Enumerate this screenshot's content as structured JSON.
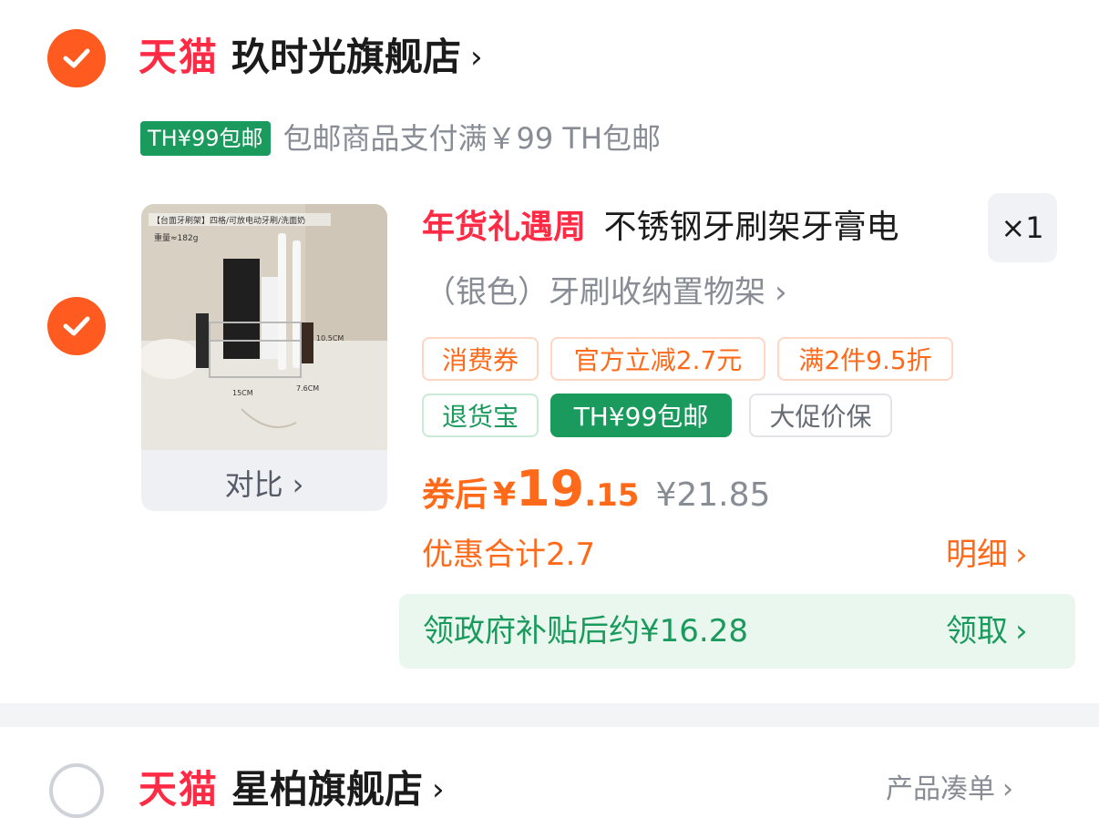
{
  "store1": {
    "brand": "天猫",
    "name": "玖时光旗舰店",
    "chevron": "›",
    "shipping_badge": "TH¥99包邮",
    "shipping_note": "包邮商品支付满￥99 TH包邮"
  },
  "product": {
    "promo_tag": "年货礼遇周",
    "title": "不锈钢牙刷架牙膏电",
    "spec": "（银色）牙刷收纳置物架",
    "quantity": "×1",
    "compare_label": "对比",
    "image_text": {
      "banner": "【台面牙刷架】四格/可放电动牙刷/洗面奶",
      "weight": "重量≈182g",
      "dim_width": "15CM",
      "dim_depth": "7.6CM",
      "dim_height": "10.5CM"
    },
    "tags_row1": [
      "消费券",
      "官方立减2.7元",
      "满2件9.5折"
    ],
    "tags_row2": [
      "退货宝",
      "TH¥99包邮",
      "大促价保"
    ],
    "price_label": "券后",
    "currency": "¥",
    "price_int": "19",
    "price_dec": ".15",
    "original_price": "¥21.85",
    "discount_total": "优惠合计2.7",
    "detail_label": "明细",
    "subsidy_text": "领政府补贴后约¥16.28",
    "subsidy_action": "领取"
  },
  "store2": {
    "brand": "天猫",
    "name": "星柏旗舰店",
    "right_label": "产品凑单"
  },
  "colors": {
    "tmall_red": "#ff2b45",
    "accent_orange": "#ff6a1a",
    "check_orange": "#ff5a1f",
    "green": "#1a9b5d"
  }
}
